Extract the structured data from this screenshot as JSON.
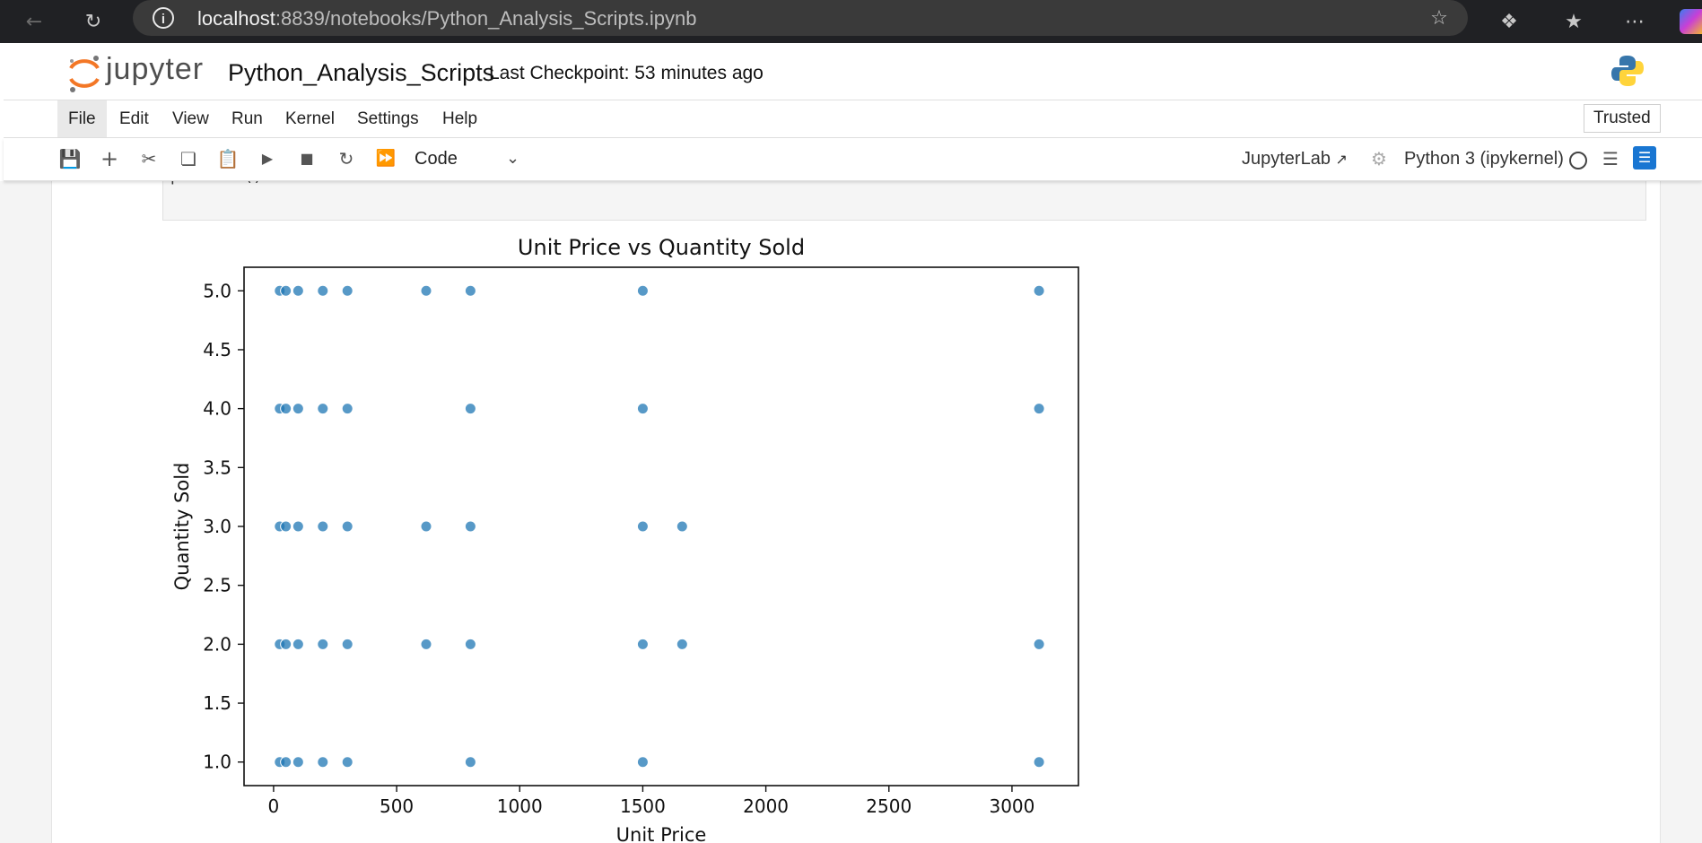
{
  "browser": {
    "url_host": "localhost",
    "url_rest": ":8839/notebooks/Python_Analysis_Scripts.ipynb"
  },
  "header": {
    "logo_text": "jupyter",
    "notebook_title": "Python_Analysis_Scripts",
    "checkpoint": "Last Checkpoint: 53 minutes ago"
  },
  "menu": {
    "items": [
      "File",
      "Edit",
      "View",
      "Run",
      "Kernel",
      "Settings",
      "Help"
    ],
    "trusted": "Trusted"
  },
  "toolbar": {
    "cell_type": "Code",
    "jupyterlab_link": "JupyterLab",
    "kernel": "Python 3 (ipykernel)"
  },
  "cell": {
    "code_partial": "plt.show()"
  },
  "chart_data": {
    "type": "scatter",
    "title": "Unit Price vs Quantity Sold",
    "xlabel": "Unit Price",
    "ylabel": "Quantity Sold",
    "xlim": [
      -120,
      3270
    ],
    "ylim": [
      0.8,
      5.2
    ],
    "xticks": [
      0,
      500,
      1000,
      1500,
      2000,
      2500,
      3000
    ],
    "yticks": [
      1.0,
      1.5,
      2.0,
      2.5,
      3.0,
      3.5,
      4.0,
      4.5,
      5.0
    ],
    "color": "#1f77b4",
    "grid": false,
    "points": [
      {
        "x": 25,
        "y": 5
      },
      {
        "x": 50,
        "y": 5
      },
      {
        "x": 100,
        "y": 5
      },
      {
        "x": 200,
        "y": 5
      },
      {
        "x": 300,
        "y": 5
      },
      {
        "x": 620,
        "y": 5
      },
      {
        "x": 800,
        "y": 5
      },
      {
        "x": 1500,
        "y": 5
      },
      {
        "x": 3110,
        "y": 5
      },
      {
        "x": 25,
        "y": 4
      },
      {
        "x": 50,
        "y": 4
      },
      {
        "x": 100,
        "y": 4
      },
      {
        "x": 200,
        "y": 4
      },
      {
        "x": 300,
        "y": 4
      },
      {
        "x": 800,
        "y": 4
      },
      {
        "x": 1500,
        "y": 4
      },
      {
        "x": 3110,
        "y": 4
      },
      {
        "x": 25,
        "y": 3
      },
      {
        "x": 50,
        "y": 3
      },
      {
        "x": 100,
        "y": 3
      },
      {
        "x": 200,
        "y": 3
      },
      {
        "x": 300,
        "y": 3
      },
      {
        "x": 620,
        "y": 3
      },
      {
        "x": 800,
        "y": 3
      },
      {
        "x": 1500,
        "y": 3
      },
      {
        "x": 1660,
        "y": 3
      },
      {
        "x": 25,
        "y": 2
      },
      {
        "x": 50,
        "y": 2
      },
      {
        "x": 100,
        "y": 2
      },
      {
        "x": 200,
        "y": 2
      },
      {
        "x": 300,
        "y": 2
      },
      {
        "x": 620,
        "y": 2
      },
      {
        "x": 800,
        "y": 2
      },
      {
        "x": 1500,
        "y": 2
      },
      {
        "x": 1660,
        "y": 2
      },
      {
        "x": 3110,
        "y": 2
      },
      {
        "x": 25,
        "y": 1
      },
      {
        "x": 50,
        "y": 1
      },
      {
        "x": 100,
        "y": 1
      },
      {
        "x": 200,
        "y": 1
      },
      {
        "x": 300,
        "y": 1
      },
      {
        "x": 800,
        "y": 1
      },
      {
        "x": 1500,
        "y": 1
      },
      {
        "x": 3110,
        "y": 1
      }
    ]
  }
}
